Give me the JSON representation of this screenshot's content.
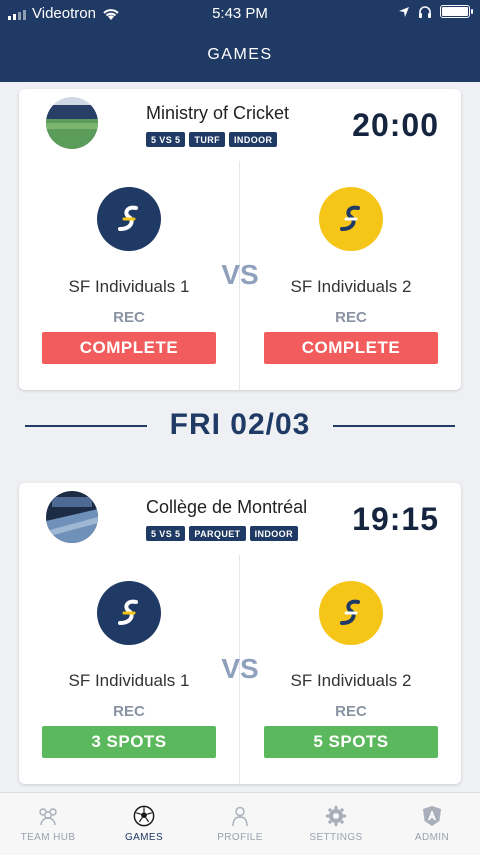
{
  "status_bar": {
    "carrier": "Videotron",
    "time": "5:43 PM"
  },
  "nav": {
    "title": "GAMES"
  },
  "colors": {
    "navy": "#1f3a64",
    "complete": "#f25c5c",
    "spots": "#5cb85c",
    "team1_logo": "#1f3a64",
    "team2_logo": "#f5c518"
  },
  "games": [
    {
      "venue": "Ministry of Cricket",
      "tags": [
        "5 VS 5",
        "TURF",
        "INDOOR"
      ],
      "time": "20:00",
      "vs": "VS",
      "home": {
        "name": "SF Individuals 1",
        "level": "REC",
        "status": "COMPLETE",
        "logo_icon": "sf-logo-icon"
      },
      "away": {
        "name": "SF Individuals 2",
        "level": "REC",
        "status": "COMPLETE",
        "logo_icon": "sf-logo-icon"
      }
    },
    {
      "venue": "Collège de Montréal",
      "tags": [
        "5 VS 5",
        "PARQUET",
        "INDOOR"
      ],
      "time": "19:15",
      "vs": "VS",
      "home": {
        "name": "SF Individuals 1",
        "level": "REC",
        "status": "3 SPOTS",
        "logo_icon": "sf-logo-icon"
      },
      "away": {
        "name": "SF Individuals 2",
        "level": "REC",
        "status": "5 SPOTS",
        "logo_icon": "sf-logo-icon"
      }
    }
  ],
  "date_separator": "FRI 02/03",
  "tabs": [
    {
      "label": "TEAM HUB",
      "icon": "team-hub-icon"
    },
    {
      "label": "GAMES",
      "icon": "soccer-ball-icon"
    },
    {
      "label": "PROFILE",
      "icon": "profile-icon"
    },
    {
      "label": "SETTINGS",
      "icon": "gear-icon"
    },
    {
      "label": "ADMIN",
      "icon": "admin-shield-icon"
    }
  ]
}
